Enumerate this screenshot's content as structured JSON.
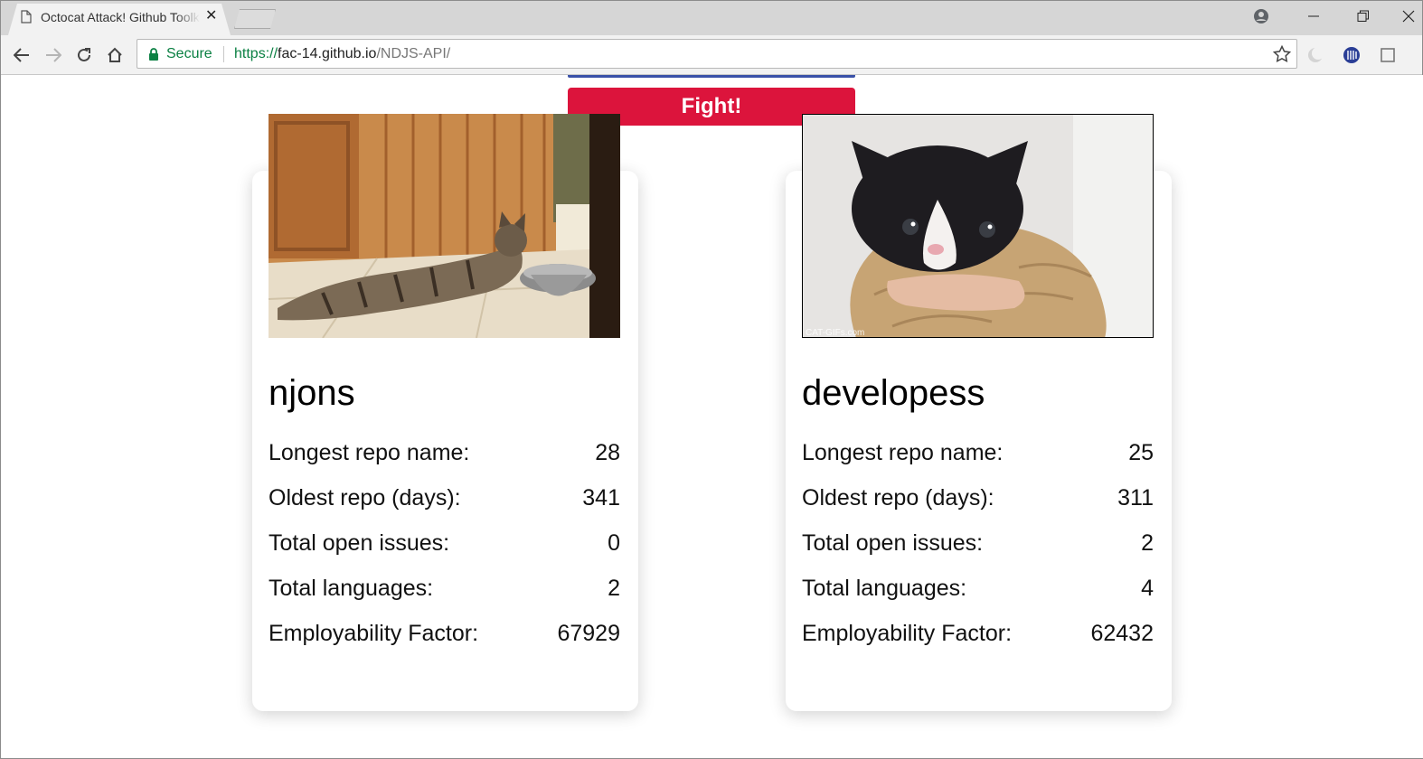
{
  "browser": {
    "tab_title": "Octocat Attack! Github Toolkit",
    "secure_label": "Secure",
    "url_scheme": "https://",
    "url_host": "fac-14.github.io",
    "url_path": "/NDJS-API/"
  },
  "page": {
    "fight_label": "Fight!",
    "fight_color": "#dc143c",
    "stat_labels": {
      "longest_repo": "Longest repo name:",
      "oldest_repo": "Oldest repo (days):",
      "open_issues": "Total open issues:",
      "languages": "Total languages:",
      "employability": "Employability Factor:"
    },
    "players": [
      {
        "username": "njons",
        "longest_repo": "28",
        "oldest_repo": "341",
        "open_issues": "0",
        "languages": "2",
        "employability": "67929"
      },
      {
        "username": "developess",
        "longest_repo": "25",
        "oldest_repo": "311",
        "open_issues": "2",
        "languages": "4",
        "employability": "62432",
        "image_watermark": "CAT-GIFs.com"
      }
    ]
  }
}
